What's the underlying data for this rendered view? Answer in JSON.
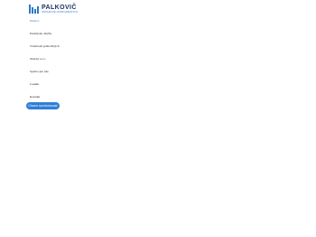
{
  "brand": {
    "name": "PALKOVIČ",
    "tagline": "ODPADOVÉ HOSPODÁRSTVO",
    "bar_color": "#2a78c9",
    "text_color": "#1a2c5b"
  },
  "nav": {
    "items": [
      {
        "label": "Domov",
        "active": true
      },
      {
        "label": "Prenájom, služby",
        "active": false
      },
      {
        "label": "Vlastnosti jednotlivých",
        "active": false
      },
      {
        "label": "Zberný s.r.o.",
        "active": false
      },
      {
        "label": "Správa pre nás",
        "active": false
      },
      {
        "label": "Cenník",
        "active": false
      },
      {
        "label": "Kontakt",
        "active": false
      }
    ]
  },
  "cta": {
    "label": "Chcem sa informovať",
    "color": "#2f7fd6"
  }
}
